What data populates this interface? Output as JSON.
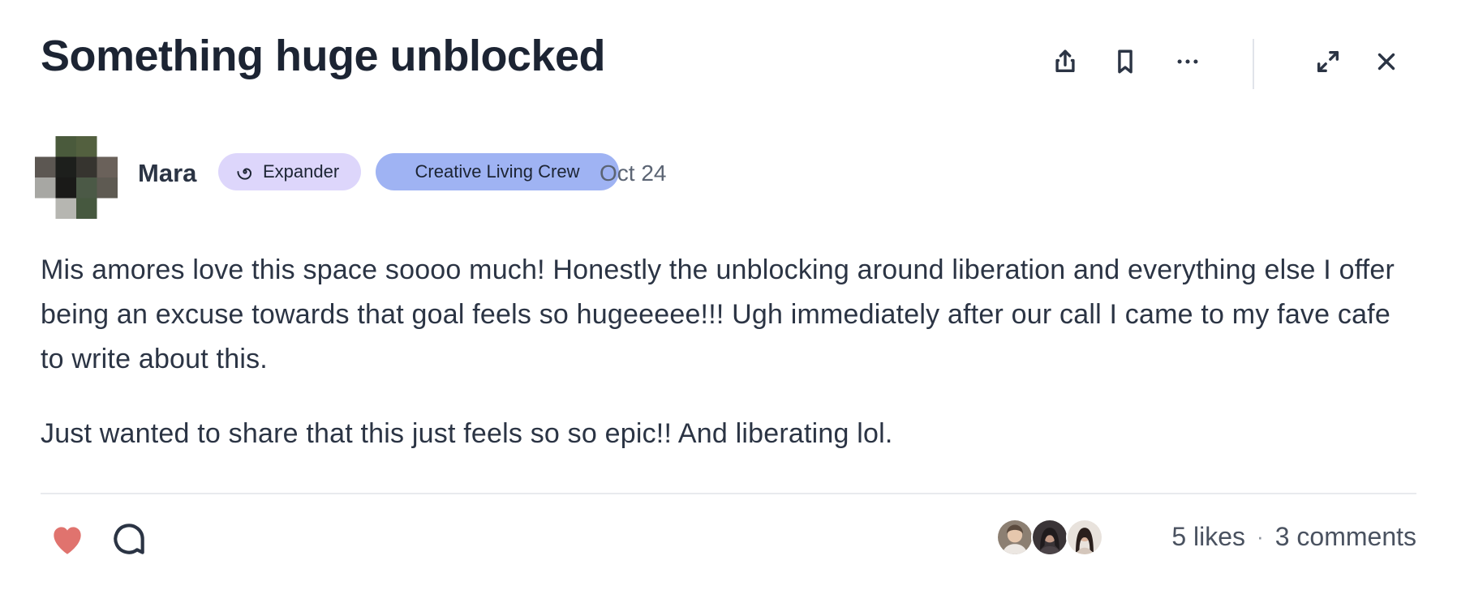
{
  "post": {
    "title": "Something huge unblocked",
    "author": {
      "name": "Mara",
      "avatar_icon": "pixelated-avatar"
    },
    "badges": {
      "membership": {
        "label": "Expander",
        "icon": "spiral-icon",
        "color": "#ddd6fb"
      },
      "group": {
        "label": "Creative Living Crew",
        "color": "#9fb3f3"
      }
    },
    "date": "Oct 24",
    "paragraphs": [
      "Mis amores love this space soooo much! Honestly the unblocking around liberation and everything else I offer being an excuse towards that goal feels so hugeeeee!!! Ugh immediately after our call I came to my fave cafe to write about this.",
      "Just wanted to share that this just feels so so epic!! And liberating lol."
    ]
  },
  "toolbar": {
    "share_icon": "share-icon",
    "bookmark_icon": "bookmark-icon",
    "more_icon": "more-icon",
    "expand_icon": "expand-icon",
    "close_icon": "close-icon"
  },
  "footer": {
    "like_icon": "heart-icon",
    "like_color": "#e0736e",
    "comment_icon": "comment-icon",
    "likes_text": "5 likes",
    "separator": "·",
    "comments_text": "3 comments"
  }
}
